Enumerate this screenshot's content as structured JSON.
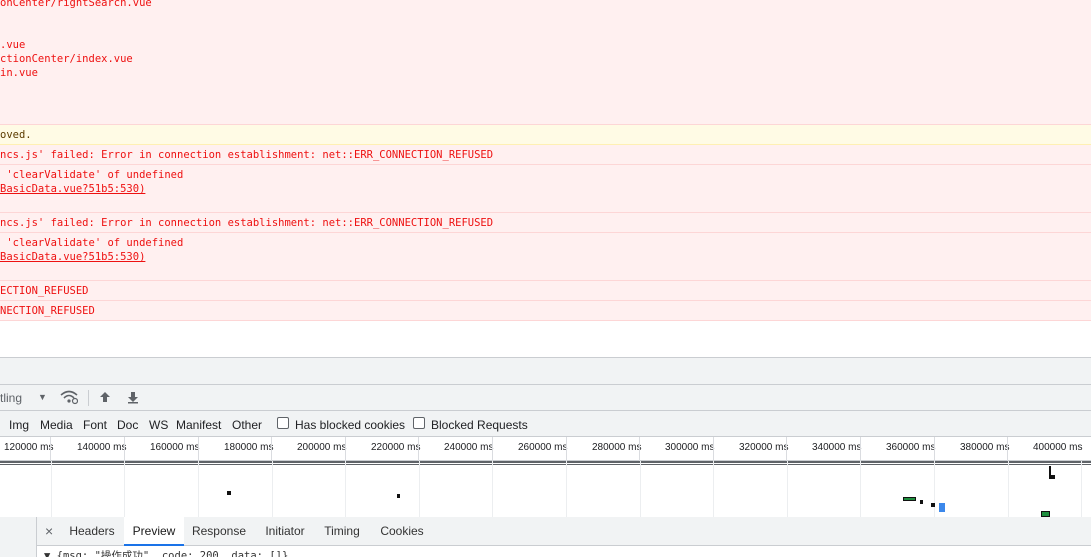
{
  "console": {
    "block1": {
      "lines": [
        "onCenter/rightSearch.vue",
        ".vue",
        "ctionCenter/index.vue",
        "in.vue"
      ]
    },
    "warning": "oved.",
    "errors": [
      {
        "lines": [
          "ncs.js' failed: Error in connection establishment: net::ERR_CONNECTION_REFUSED"
        ]
      },
      {
        "lines": [
          " 'clearValidate' of undefined",
          "BasicData.vue?51b5:530)"
        ]
      },
      {
        "lines": [
          "ncs.js' failed: Error in connection establishment: net::ERR_CONNECTION_REFUSED"
        ]
      },
      {
        "lines": [
          " 'clearValidate' of undefined",
          "BasicData.vue?51b5:530)"
        ]
      },
      {
        "lines": [
          "ECTION_REFUSED"
        ]
      },
      {
        "lines": [
          "NECTION_REFUSED"
        ]
      }
    ]
  },
  "network_toolbar": {
    "throttling_label": "tling",
    "dropdown_arrow": "▼"
  },
  "filter_bar": {
    "types": [
      "Img",
      "Media",
      "Font",
      "Doc",
      "WS",
      "Manifest",
      "Other"
    ],
    "has_blocked_cookies": "Has blocked cookies",
    "blocked_requests": "Blocked Requests"
  },
  "timeline": {
    "ticks": [
      "120000 ms",
      "140000 ms",
      "160000 ms",
      "180000 ms",
      "200000 ms",
      "220000 ms",
      "240000 ms",
      "260000 ms",
      "280000 ms",
      "300000 ms",
      "320000 ms",
      "340000 ms",
      "360000 ms",
      "380000 ms",
      "400000 ms"
    ]
  },
  "details": {
    "close": "×",
    "tabs": [
      "Headers",
      "Preview",
      "Response",
      "Initiator",
      "Timing",
      "Cookies"
    ],
    "active_tab": "Preview",
    "preview_line": "▼ {msg: \"操作成功\", code: 200, data: []}"
  },
  "colors": {
    "error_bg": "#fff0f0",
    "error_text": "#ee1111",
    "warning_bg": "#fffbe5",
    "accent": "#1a73e8"
  }
}
